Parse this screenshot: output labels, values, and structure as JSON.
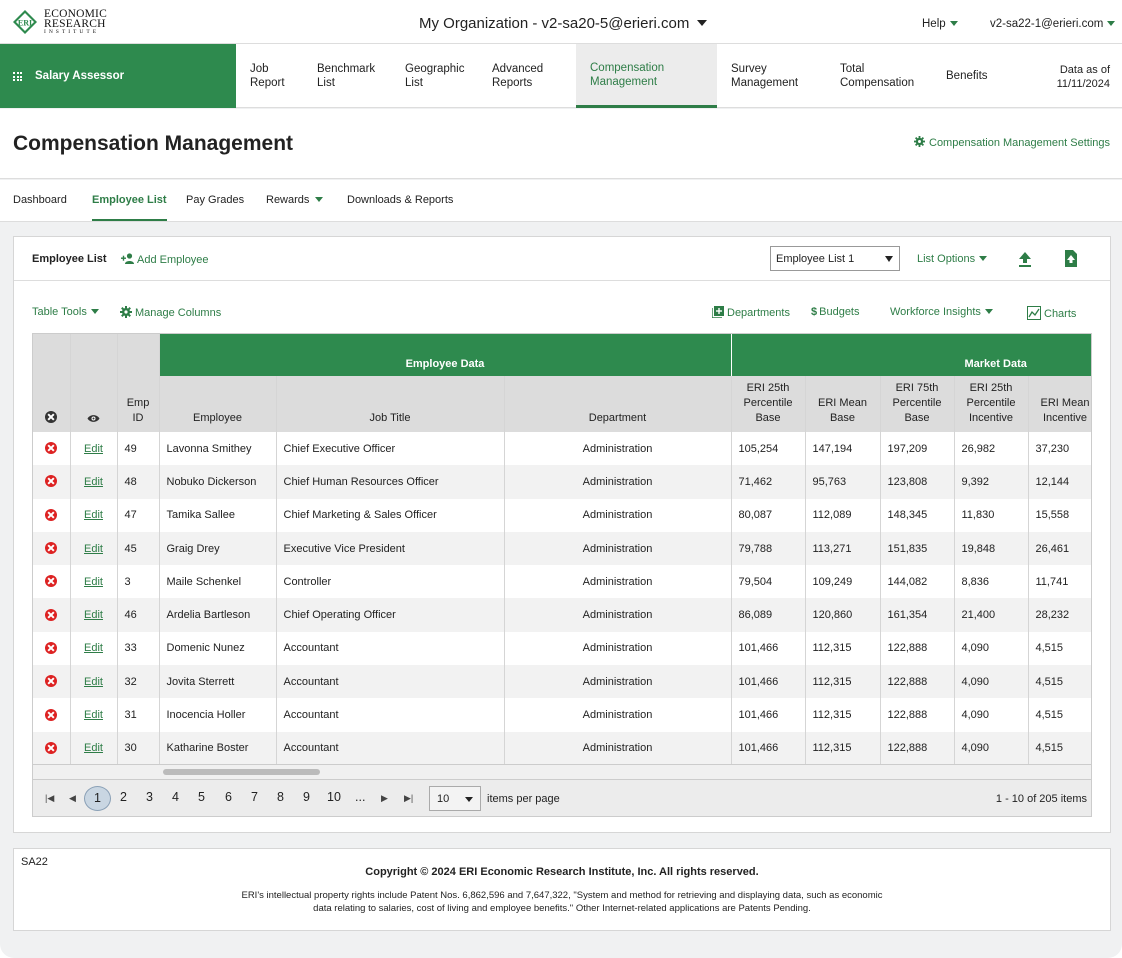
{
  "brand": {
    "logo_lines": [
      "ECONOMIC",
      "RESEARCH",
      "INSTITUTE"
    ],
    "logo_mark": "ERI"
  },
  "topbar": {
    "org_label": "My Organization - v2-sa20-5@erieri.com",
    "help_label": "Help",
    "user_label": "v2-sa22-1@erieri.com"
  },
  "nav": {
    "app_name": "Salary Assessor",
    "items": [
      {
        "line1": "Job",
        "line2": "Report"
      },
      {
        "line1": "Benchmark",
        "line2": "List"
      },
      {
        "line1": "Geographic",
        "line2": "List"
      },
      {
        "line1": "Advanced",
        "line2": "Reports"
      },
      {
        "line1": "Compensation",
        "line2": "Management"
      },
      {
        "line1": "Survey",
        "line2": "Management"
      },
      {
        "line1": "Total",
        "line2": "Compensation"
      },
      {
        "line1": "Benefits",
        "line2": ""
      }
    ],
    "active_index": 4,
    "data_as_of_label": "Data as of",
    "data_as_of_date": "11/11/2024"
  },
  "page": {
    "title": "Compensation Management",
    "settings_link": "Compensation Management Settings"
  },
  "subtabs": [
    "Dashboard",
    "Employee List",
    "Pay Grades",
    "Rewards",
    "Downloads & Reports"
  ],
  "card": {
    "title": "Employee List",
    "add_employee": "Add Employee",
    "list_select_value": "Employee List 1",
    "list_options": "List Options"
  },
  "toolbar": {
    "table_tools": "Table Tools",
    "manage_columns": "Manage Columns",
    "departments": "Departments",
    "budgets": "Budgets",
    "workforce_insights": "Workforce Insights",
    "charts": "Charts"
  },
  "table": {
    "groups": {
      "employee_data": "Employee Data",
      "market_data": "Market Data"
    },
    "columns": {
      "emp_id": "Emp ID",
      "employee": "Employee",
      "job_title": "Job Title",
      "department": "Department",
      "eri25_base": "ERI 25th Percentile Base",
      "erimean_base": "ERI Mean Base",
      "eri75_base": "ERI 75th Percentile Base",
      "eri25_incentive": "ERI 25th Percentile Incentive",
      "erimean_incentive": "ERI Mean Incentive"
    },
    "edit_label": "Edit",
    "rows": [
      {
        "id": "49",
        "name": "Lavonna Smithey",
        "title": "Chief Executive Officer",
        "dept": "Administration",
        "p25": "105,254",
        "mean": "147,194",
        "p75": "197,209",
        "i25": "26,982",
        "imean": "37,230"
      },
      {
        "id": "48",
        "name": "Nobuko Dickerson",
        "title": "Chief Human Resources Officer",
        "dept": "Administration",
        "p25": "71,462",
        "mean": "95,763",
        "p75": "123,808",
        "i25": "9,392",
        "imean": "12,144"
      },
      {
        "id": "47",
        "name": "Tamika Sallee",
        "title": "Chief Marketing & Sales Officer",
        "dept": "Administration",
        "p25": "80,087",
        "mean": "112,089",
        "p75": "148,345",
        "i25": "11,830",
        "imean": "15,558"
      },
      {
        "id": "45",
        "name": "Graig Drey",
        "title": "Executive Vice President",
        "dept": "Administration",
        "p25": "79,788",
        "mean": "113,271",
        "p75": "151,835",
        "i25": "19,848",
        "imean": "26,461"
      },
      {
        "id": "3",
        "name": "Maile Schenkel",
        "title": "Controller",
        "dept": "Administration",
        "p25": "79,504",
        "mean": "109,249",
        "p75": "144,082",
        "i25": "8,836",
        "imean": "11,741"
      },
      {
        "id": "46",
        "name": "Ardelia Bartleson",
        "title": "Chief Operating Officer",
        "dept": "Administration",
        "p25": "86,089",
        "mean": "120,860",
        "p75": "161,354",
        "i25": "21,400",
        "imean": "28,232"
      },
      {
        "id": "33",
        "name": "Domenic Nunez",
        "title": "Accountant",
        "dept": "Administration",
        "p25": "101,466",
        "mean": "112,315",
        "p75": "122,888",
        "i25": "4,090",
        "imean": "4,515"
      },
      {
        "id": "32",
        "name": "Jovita Sterrett",
        "title": "Accountant",
        "dept": "Administration",
        "p25": "101,466",
        "mean": "112,315",
        "p75": "122,888",
        "i25": "4,090",
        "imean": "4,515"
      },
      {
        "id": "31",
        "name": "Inocencia Holler",
        "title": "Accountant",
        "dept": "Administration",
        "p25": "101,466",
        "mean": "112,315",
        "p75": "122,888",
        "i25": "4,090",
        "imean": "4,515"
      },
      {
        "id": "30",
        "name": "Katharine Boster",
        "title": "Accountant",
        "dept": "Administration",
        "p25": "101,466",
        "mean": "112,315",
        "p75": "122,888",
        "i25": "4,090",
        "imean": "4,515"
      }
    ]
  },
  "pager": {
    "pages": [
      "1",
      "2",
      "3",
      "4",
      "5",
      "6",
      "7",
      "8",
      "9",
      "10",
      "..."
    ],
    "current": "1",
    "per_page_value": "10",
    "per_page_label": "items per page",
    "range": "1 - 10 of 205 items"
  },
  "footer": {
    "code": "SA22",
    "copyright": "Copyright © 2024 ERI Economic Research Institute, Inc. All rights reserved.",
    "legal_line1": "ERI's intellectual property rights include Patent Nos. 6,862,596 and 7,647,322, \"System and method for retrieving and displaying data, such as economic",
    "legal_line2": "data relating to salaries, cost of living and employee benefits.\" Other Internet-related applications are Patents Pending."
  },
  "colors": {
    "brand_green": "#2e8a4e",
    "link_green": "#2e7d47",
    "delete_red": "#dd2222"
  }
}
